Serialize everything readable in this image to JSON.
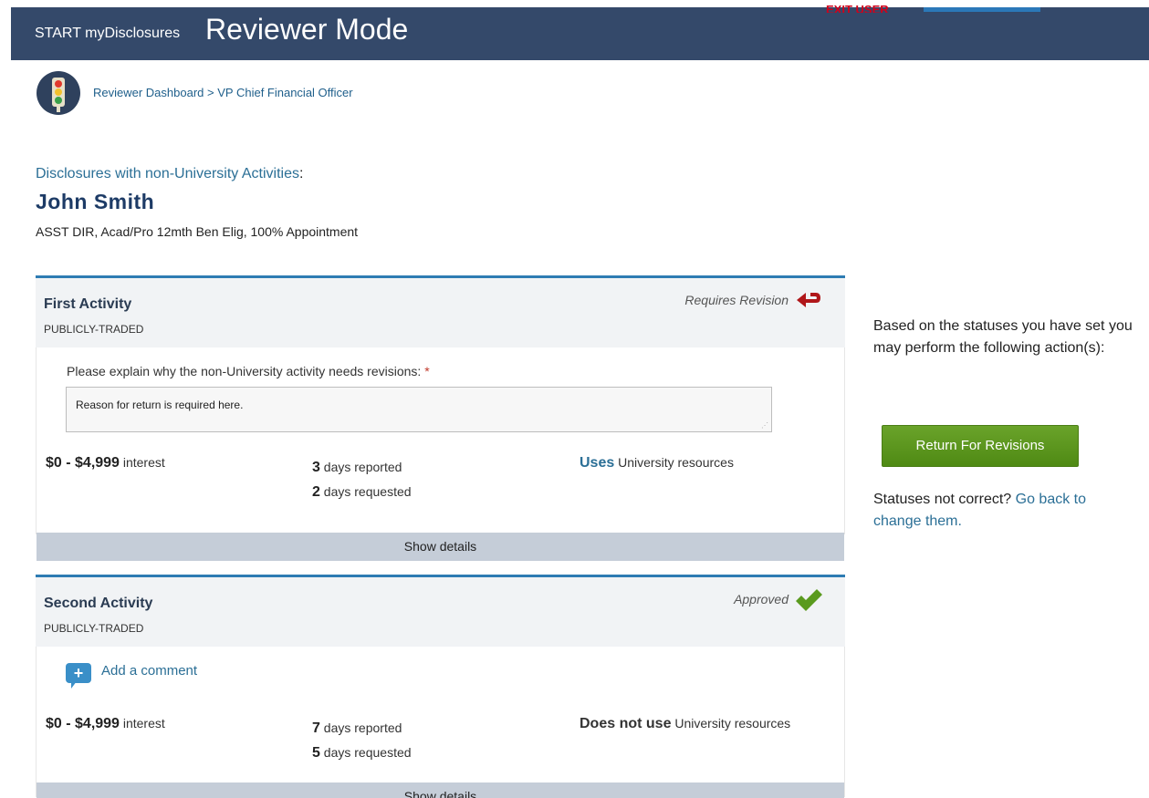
{
  "header": {
    "brand_small": "START myDisclosures",
    "brand_big": "Reviewer Mode",
    "exit_user": "EXIT USER"
  },
  "breadcrumb": {
    "dashboard": "Reviewer Dashboard",
    "separator": " > ",
    "current": "VP Chief Financial Officer"
  },
  "disclosure": {
    "heading": "Disclosures with non-University Activities",
    "heading_colon": ":",
    "person_name": "John Smith",
    "person_title": "ASST DIR, Acad/Pro 12mth Ben Elig, 100% Appointment"
  },
  "activities": [
    {
      "name": "First Activity",
      "type": "PUBLICLY-TRADED",
      "status": "Requires Revision",
      "status_icon": "return-arrow-icon",
      "explain_label": "Please explain why the non-University activity needs revisions:",
      "required_mark": "*",
      "reason_value": "Reason for return is required here.",
      "interest_range": "$0 - $4,999",
      "interest_label": "interest",
      "days_reported": "3",
      "days_reported_label": "days reported",
      "days_requested": "2",
      "days_requested_label": "days requested",
      "resources_strong": "Uses",
      "resources_label": "University resources",
      "show_details": "Show details"
    },
    {
      "name": "Second Activity",
      "type": "PUBLICLY-TRADED",
      "status": "Approved",
      "status_icon": "checkmark-icon",
      "add_comment": "Add a comment",
      "interest_range": "$0 - $4,999",
      "interest_label": "interest",
      "days_reported": "7",
      "days_reported_label": "days reported",
      "days_requested": "5",
      "days_requested_label": "days requested",
      "resources_strong": "Does not use",
      "resources_label": "University resources",
      "show_details": "Show details"
    }
  ],
  "side_panel": {
    "message": "Based on the statuses you have set you may perform the following action(s):",
    "return_button": "Return For Revisions",
    "not_correct_text": "Statuses not correct?",
    "go_back_link": "Go back to change them."
  },
  "colors": {
    "header_bg": "#34496a",
    "accent_blue": "#2e7cb3",
    "link": "#2b6f96",
    "button_green": "#5a9620",
    "revision_red": "#b0171a",
    "approved_green": "#5a9a1e"
  }
}
